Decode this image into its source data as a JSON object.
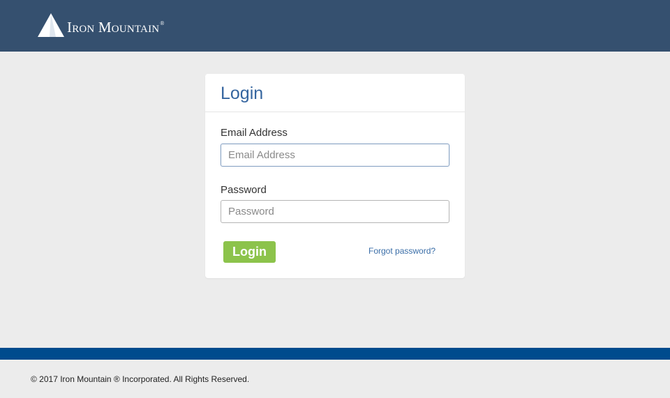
{
  "header": {
    "logo_text": "Iron Mountain",
    "logo_registered": "®",
    "background_color": "#35506f"
  },
  "login_card": {
    "title": "Login",
    "email": {
      "label": "Email Address",
      "placeholder": "Email Address",
      "value": ""
    },
    "password": {
      "label": "Password",
      "placeholder": "Password",
      "value": ""
    },
    "login_button_label": "Login",
    "forgot_password_link": "Forgot password?",
    "title_color": "#35659f",
    "button_color": "#8cc34b"
  },
  "footer": {
    "copyright": "© 2017 Iron Mountain ® Incorporated. All Rights Reserved.",
    "band_color": "#004b8d"
  }
}
